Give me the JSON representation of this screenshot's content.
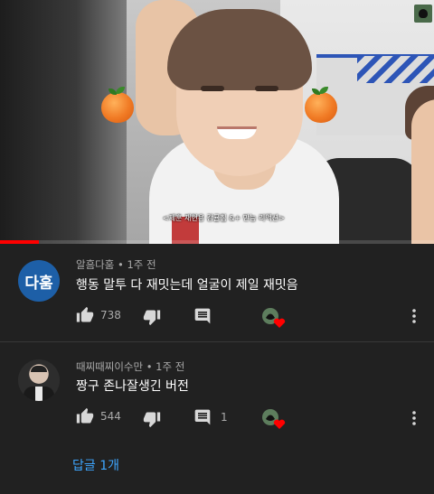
{
  "video": {
    "caption": "<제훈 재현용 감귤칩 &+ 만능 리액션>",
    "progress": 0.09
  },
  "comments": [
    {
      "avatar_text": "다훔",
      "avatar_color": "#1d5fa7",
      "author": "알흠다훔",
      "time": "1주 전",
      "text": "행동 말투 다 재밋는데 얼굴이 제일 재밋음",
      "likes": "738",
      "replies": ""
    },
    {
      "avatar_text": "",
      "author": "때찌때찌이수만",
      "time": "1주 전",
      "text": "짱구 존나잘생긴 버전",
      "likes": "544",
      "replies": "1"
    }
  ],
  "replies_link": "답글 1개",
  "icons": {
    "like": "thumbs-up-icon",
    "dislike": "thumbs-down-icon",
    "reply": "reply-comment-icon",
    "creator_heart": "creator-heart-icon",
    "more": "more-vert-icon"
  },
  "colors": {
    "background": "#212121",
    "link": "#3ea6ff",
    "heart": "#ff0000",
    "progress": "#ff0000"
  }
}
